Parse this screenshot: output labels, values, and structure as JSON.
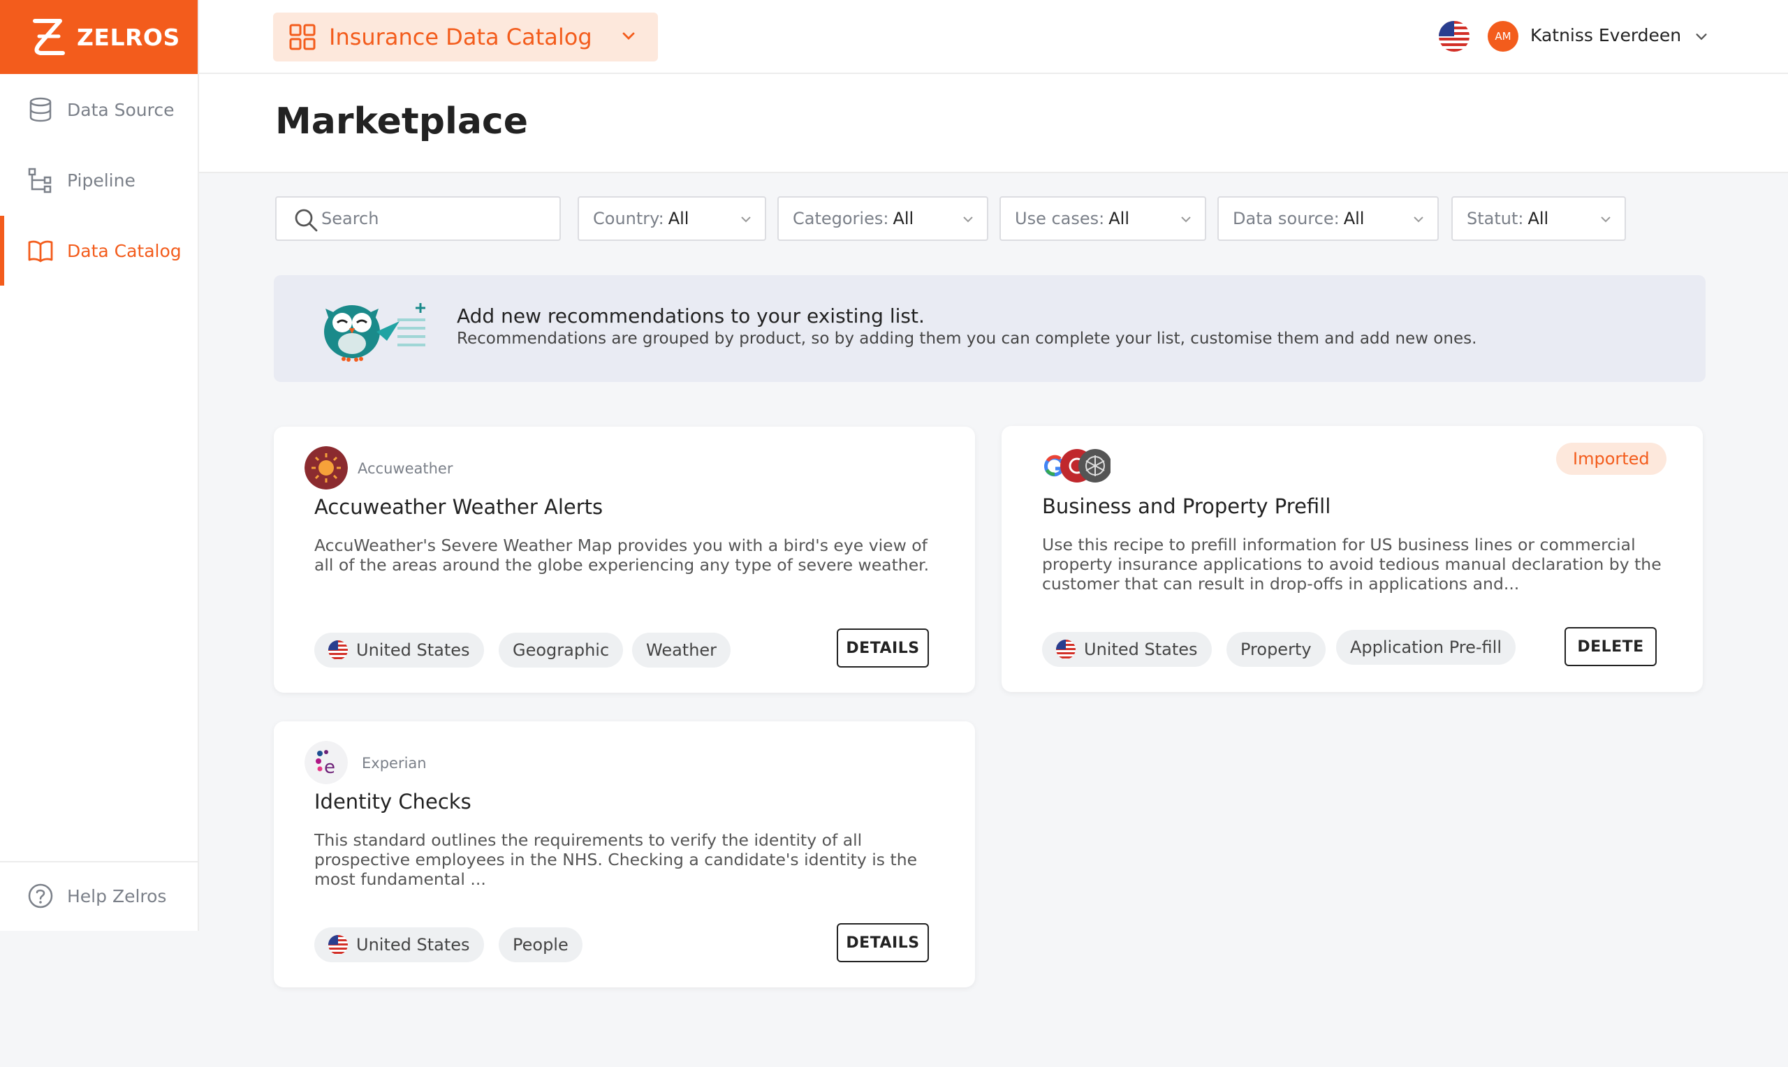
{
  "brand": {
    "name": "ZELROS",
    "color": "#f35c1c"
  },
  "sidebar": {
    "items": [
      {
        "label": "Data Source",
        "icon": "database-icon",
        "active": false
      },
      {
        "label": "Pipeline",
        "icon": "pipeline-icon",
        "active": false
      },
      {
        "label": "Data Catalog",
        "icon": "book-icon",
        "active": true
      }
    ],
    "help_label": "Help Zelros"
  },
  "header": {
    "catalog_title": "Insurance Data Catalog",
    "language_flag": "us-flag-icon",
    "user_initials": "AM",
    "user_name": "Katniss Everdeen"
  },
  "page": {
    "title": "Marketplace"
  },
  "filters": {
    "search_placeholder": "Search",
    "country": {
      "label": "Country:",
      "value": "All"
    },
    "categories": {
      "label": "Categories:",
      "value": "All"
    },
    "use_cases": {
      "label": "Use cases:",
      "value": "All"
    },
    "data_source": {
      "label": "Data source:",
      "value": "All"
    },
    "statut": {
      "label": "Statut:",
      "value": "All"
    }
  },
  "banner": {
    "title": "Add new recommendations to your existing list.",
    "subtitle": "Recommendations are grouped by product, so by adding them you can complete your list, customise them and add new ones."
  },
  "cards": [
    {
      "provider": "Accuweather",
      "title": "Accuweather Weather Alerts",
      "description": "AccuWeather's Severe Weather Map provides you with a bird's eye view of all of the areas around the globe experiencing any type of severe weather.",
      "tags": [
        "United States",
        "Geographic",
        "Weather"
      ],
      "action": "DETAILS"
    },
    {
      "provider": "",
      "title": "Business and Property Prefill",
      "description": "Use this recipe to prefill information for US business lines or commercial property insurance applications to avoid tedious manual declaration by the customer that can result in drop-offs in applications and...",
      "tags": [
        "United States",
        "Property",
        "Application Pre-fill"
      ],
      "action": "DELETE",
      "badge": "Imported"
    },
    {
      "provider": "Experian",
      "title": "Identity Checks",
      "description": "This standard outlines the requirements to verify the identity of all prospective employees in the NHS. Checking a candidate's identity is the most fundamental ...",
      "tags": [
        "United States",
        "People"
      ],
      "action": "DETAILS"
    }
  ]
}
